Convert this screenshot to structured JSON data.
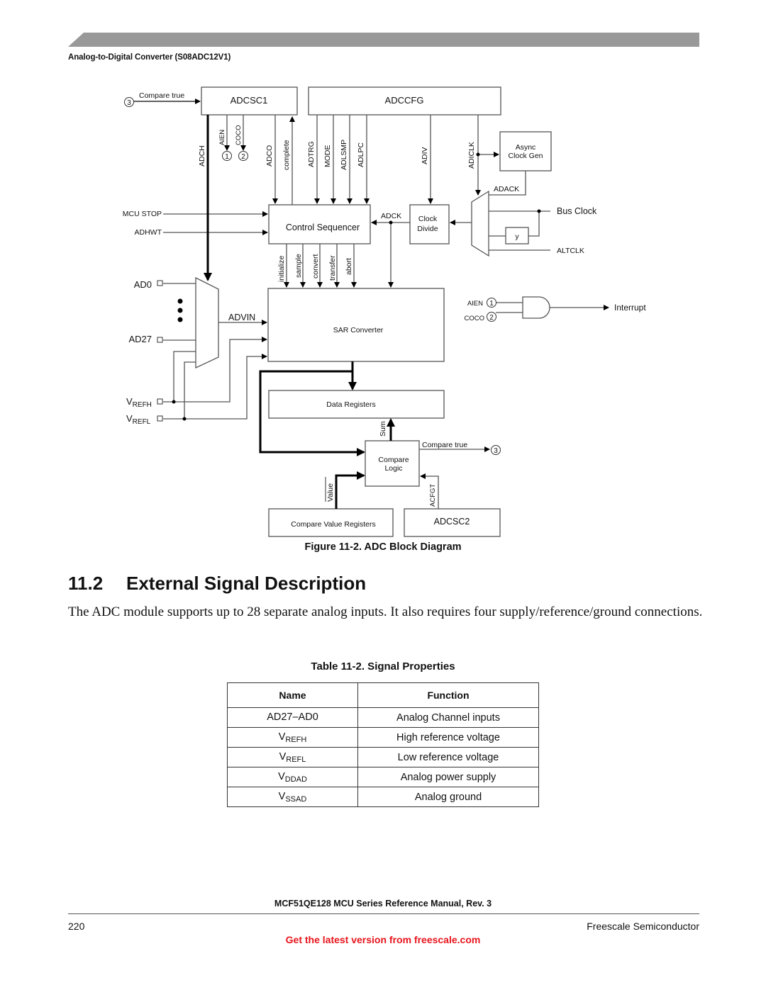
{
  "header": {
    "running_head": "Analog-to-Digital Converter (S08ADC12V1)",
    "banner_color": "#999999"
  },
  "figure": {
    "caption": "Figure 11-2. ADC Block Diagram",
    "blocks": {
      "adcsc1": "ADCSC1",
      "adccfg": "ADCCFG",
      "async_clock_gen_line1": "Async",
      "async_clock_gen_line2": "Clock Gen",
      "clock_divide_line1": "Clock",
      "clock_divide_line2": "Divide",
      "y_block": "y",
      "control_sequencer": "Control Sequencer",
      "sar_converter": "SAR Converter",
      "data_registers": "Data Registers",
      "compare_logic_line1": "Compare",
      "compare_logic_line2": "Logic",
      "compare_value_registers": "Compare Value Registers",
      "adcsc2": "ADCSC2"
    },
    "signals": {
      "compare_true_in": "Compare true",
      "compare_true_out": "Compare true",
      "adch": "ADCH",
      "aien": "AIEN",
      "coco": "COCO",
      "adco": "ADCO",
      "complete": "complete",
      "adtrg": "ADTRG",
      "mode": "MODE",
      "adlsmp": "ADLSMP",
      "adlpc": "ADLPC",
      "adiv": "ADIV",
      "adiclk": "ADICLK",
      "adack": "ADACK",
      "adck": "ADCK",
      "bus_clock": "Bus Clock",
      "altclk": "ALTCLK",
      "mcu_stop": "MCU STOP",
      "adhwt": "ADHWT",
      "initialize": "initialize",
      "sample": "sample",
      "convert": "convert",
      "transfer": "transfer",
      "abort": "abort",
      "ad0": "AD0",
      "ad27": "AD27",
      "advin": "ADVIN",
      "vrefh_main": "V",
      "vrefh_sub": "REFH",
      "vrefl_main": "V",
      "vrefl_sub": "REFL",
      "interrupt": "Interrupt",
      "gate_aien": "AIEN",
      "gate_coco": "COCO",
      "sum": "Sum",
      "value": "Value",
      "acfgt": "ACFGT"
    },
    "connectors": {
      "one": "1",
      "two": "2",
      "three": "3"
    }
  },
  "section": {
    "number": "11.2",
    "title": "External Signal Description",
    "paragraph": "The ADC module supports up to 28 separate analog inputs. It also requires four supply/reference/ground connections."
  },
  "table": {
    "caption": "Table 11-2. Signal Properties",
    "headers": [
      "Name",
      "Function"
    ],
    "rows": [
      {
        "name": "AD27–AD0",
        "name_sub": "",
        "function": "Analog Channel inputs"
      },
      {
        "name": "V",
        "name_sub": "REFH",
        "function": "High reference voltage"
      },
      {
        "name": "V",
        "name_sub": "REFL",
        "function": "Low reference voltage"
      },
      {
        "name": "V",
        "name_sub": "DDAD",
        "function": "Analog power supply"
      },
      {
        "name": "V",
        "name_sub": "SSAD",
        "function": "Analog ground"
      }
    ]
  },
  "footer": {
    "manual_title": "MCF51QE128 MCU Series Reference Manual, Rev. 3",
    "page_number": "220",
    "publisher": "Freescale Semiconductor",
    "latest_version_link": "Get the latest version from freescale.com",
    "link_color": "#e8141c"
  }
}
